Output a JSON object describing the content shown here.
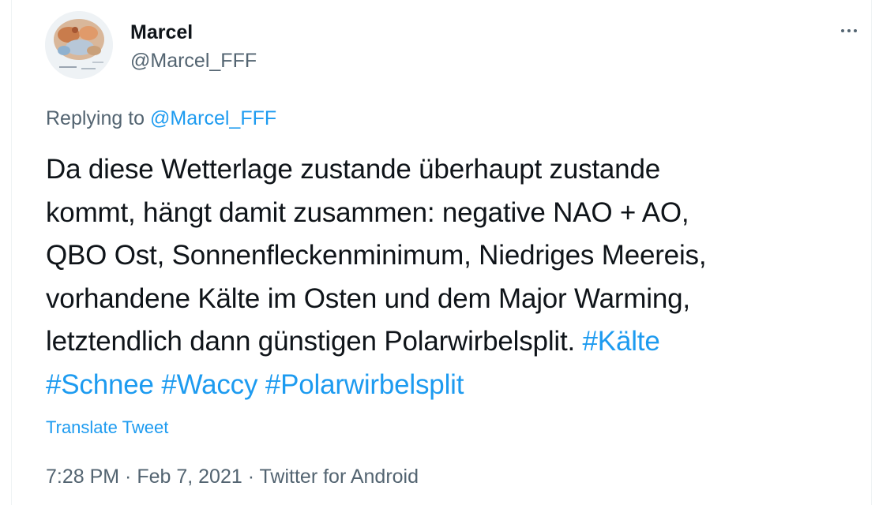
{
  "user": {
    "display_name": "Marcel",
    "handle": "@Marcel_FFF"
  },
  "menu": {
    "more_icon": "more-horizontal-icon"
  },
  "reply": {
    "prefix": "Replying to ",
    "mention": "@Marcel_FFF"
  },
  "tweet": {
    "lines": [
      "Da diese Wetterlage zustande überhaupt zustande",
      "kommt, hängt damit zusammen: negative NAO + AO,",
      "QBO Ost, Sonnenfleckenminimum, Niedriges Meereis,",
      "vorhandene Kälte im Osten und dem Major Warming,",
      "letztendlich dann günstigen Polarwirbelsplit. "
    ],
    "hashtags": [
      "#Kälte",
      "#Schnee",
      "#Waccy",
      "#Polarwirbelsplit"
    ]
  },
  "translate_label": "Translate Tweet",
  "meta": {
    "time": "7:28 PM",
    "separator": " · ",
    "date": "Feb 7, 2021",
    "source": "Twitter for Android"
  },
  "colors": {
    "text": "#0f1419",
    "secondary": "#536471",
    "link": "#1d9bf0"
  }
}
